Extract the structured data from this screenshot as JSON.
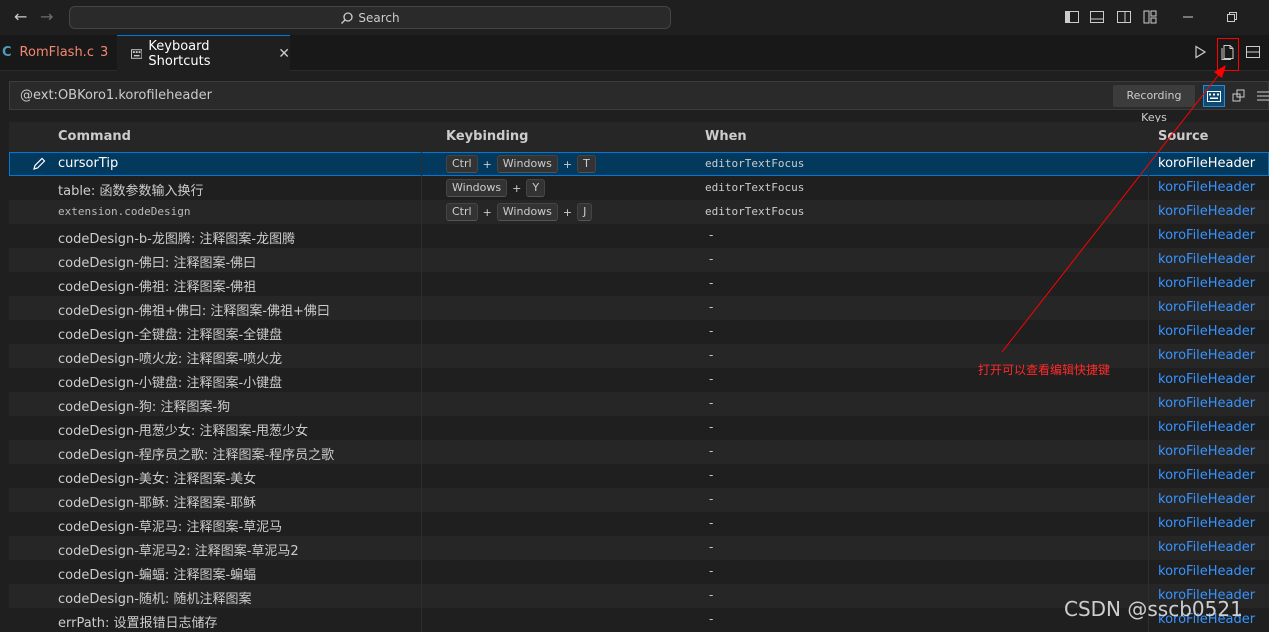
{
  "titlebar": {
    "search_label": "Search"
  },
  "tabs": [
    {
      "label": "RomFlash.c",
      "badge": "3",
      "icon": "c-file-icon",
      "active": false
    },
    {
      "label": "Keyboard Shortcuts",
      "icon": "keyboard-icon",
      "active": true
    }
  ],
  "filter": {
    "value": "@ext:OBKoro1.korofileheader",
    "recording_keys_label": "Recording Keys"
  },
  "table": {
    "headers": {
      "command": "Command",
      "keybinding": "Keybinding",
      "when": "When",
      "source": "Source"
    },
    "rows": [
      {
        "command": "cursorTip",
        "keys": [
          "Ctrl",
          "Windows",
          "T"
        ],
        "when": "editorTextFocus",
        "source": "koroFileHeader",
        "selected": true
      },
      {
        "command": "table: 函数参数输入换行",
        "keys": [
          "Windows",
          "Y"
        ],
        "when": "editorTextFocus",
        "source": "koroFileHeader"
      },
      {
        "command": "extension.codeDesign",
        "keys": [
          "Ctrl",
          "Windows",
          "J"
        ],
        "when": "editorTextFocus",
        "source": "koroFileHeader",
        "mono": true
      },
      {
        "command": "codeDesign-b-龙图腾: 注释图案-龙图腾",
        "keys": [],
        "when": "-",
        "source": "koroFileHeader"
      },
      {
        "command": "codeDesign-佛曰: 注释图案-佛曰",
        "keys": [],
        "when": "-",
        "source": "koroFileHeader"
      },
      {
        "command": "codeDesign-佛祖: 注释图案-佛祖",
        "keys": [],
        "when": "-",
        "source": "koroFileHeader"
      },
      {
        "command": "codeDesign-佛祖+佛曰: 注释图案-佛祖+佛曰",
        "keys": [],
        "when": "-",
        "source": "koroFileHeader"
      },
      {
        "command": "codeDesign-全键盘: 注释图案-全键盘",
        "keys": [],
        "when": "-",
        "source": "koroFileHeader"
      },
      {
        "command": "codeDesign-喷火龙: 注释图案-喷火龙",
        "keys": [],
        "when": "-",
        "source": "koroFileHeader"
      },
      {
        "command": "codeDesign-小键盘: 注释图案-小键盘",
        "keys": [],
        "when": "-",
        "source": "koroFileHeader"
      },
      {
        "command": "codeDesign-狗: 注释图案-狗",
        "keys": [],
        "when": "-",
        "source": "koroFileHeader"
      },
      {
        "command": "codeDesign-甩葱少女: 注释图案-甩葱少女",
        "keys": [],
        "when": "-",
        "source": "koroFileHeader"
      },
      {
        "command": "codeDesign-程序员之歌: 注释图案-程序员之歌",
        "keys": [],
        "when": "-",
        "source": "koroFileHeader"
      },
      {
        "command": "codeDesign-美女: 注释图案-美女",
        "keys": [],
        "when": "-",
        "source": "koroFileHeader"
      },
      {
        "command": "codeDesign-耶稣: 注释图案-耶稣",
        "keys": [],
        "when": "-",
        "source": "koroFileHeader"
      },
      {
        "command": "codeDesign-草泥马: 注释图案-草泥马",
        "keys": [],
        "when": "-",
        "source": "koroFileHeader"
      },
      {
        "command": "codeDesign-草泥马2: 注释图案-草泥马2",
        "keys": [],
        "when": "-",
        "source": "koroFileHeader"
      },
      {
        "command": "codeDesign-蝙蝠: 注释图案-蝙蝠",
        "keys": [],
        "when": "-",
        "source": "koroFileHeader"
      },
      {
        "command": "codeDesign-随机: 随机注释图案",
        "keys": [],
        "when": "-",
        "source": "koroFileHeader"
      },
      {
        "command": "errPath: 设置报错日志储存",
        "keys": [],
        "when": "-",
        "source": "koroFileHeader"
      }
    ]
  },
  "annotation": {
    "text": "打开可以查看编辑快捷键"
  },
  "watermark": "CSDN @sscb0521",
  "colors": {
    "accent": "#0078d4",
    "link": "#3794ff",
    "annotation_red": "#ff0000",
    "error_tab": "#f48771"
  }
}
